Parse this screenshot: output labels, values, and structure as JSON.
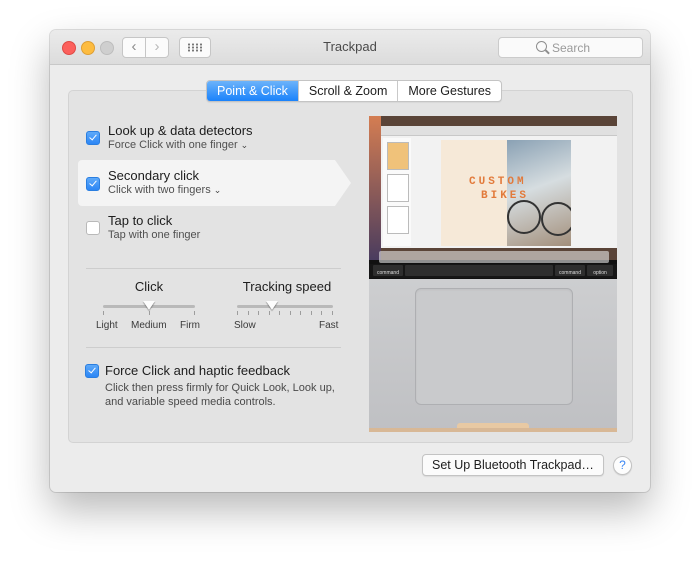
{
  "window": {
    "title": "Trackpad",
    "search_placeholder": "Search",
    "nav_back": "‹",
    "nav_forward": "›"
  },
  "tabs": [
    {
      "label": "Point & Click",
      "active": true
    },
    {
      "label": "Scroll & Zoom",
      "active": false
    },
    {
      "label": "More Gestures",
      "active": false
    }
  ],
  "options": [
    {
      "title": "Look up & data detectors",
      "subtitle": "Force Click with one finger",
      "checked": true,
      "has_dropdown": true
    },
    {
      "title": "Secondary click",
      "subtitle": "Click with two fingers",
      "checked": true,
      "has_dropdown": true,
      "selected": true
    },
    {
      "title": "Tap to click",
      "subtitle": "Tap with one finger",
      "checked": false,
      "has_dropdown": false
    }
  ],
  "sliders": {
    "click": {
      "label": "Click",
      "min_label": "Light",
      "mid_label": "Medium",
      "max_label": "Firm",
      "value": "Medium"
    },
    "tracking": {
      "label": "Tracking speed",
      "min_label": "Slow",
      "max_label": "Fast",
      "value_fraction": 0.33
    }
  },
  "force_click": {
    "title": "Force Click and haptic feedback",
    "checked": true,
    "description_line1": "Click then press firmly for Quick Look, Look up,",
    "description_line2": "and variable speed media controls."
  },
  "preview": {
    "page_text_line1": "CUSTOM",
    "page_text_line2": "BIKES",
    "key_left": "command",
    "key_right_1": "command",
    "key_right_2": "option"
  },
  "footer": {
    "bluetooth_button": "Set Up Bluetooth Trackpad…",
    "help": "?"
  },
  "colors": {
    "accent": "#2c86f5",
    "close": "#fc605c",
    "minimize": "#fdbc40",
    "maximize_disabled": "#cfcfcf"
  }
}
